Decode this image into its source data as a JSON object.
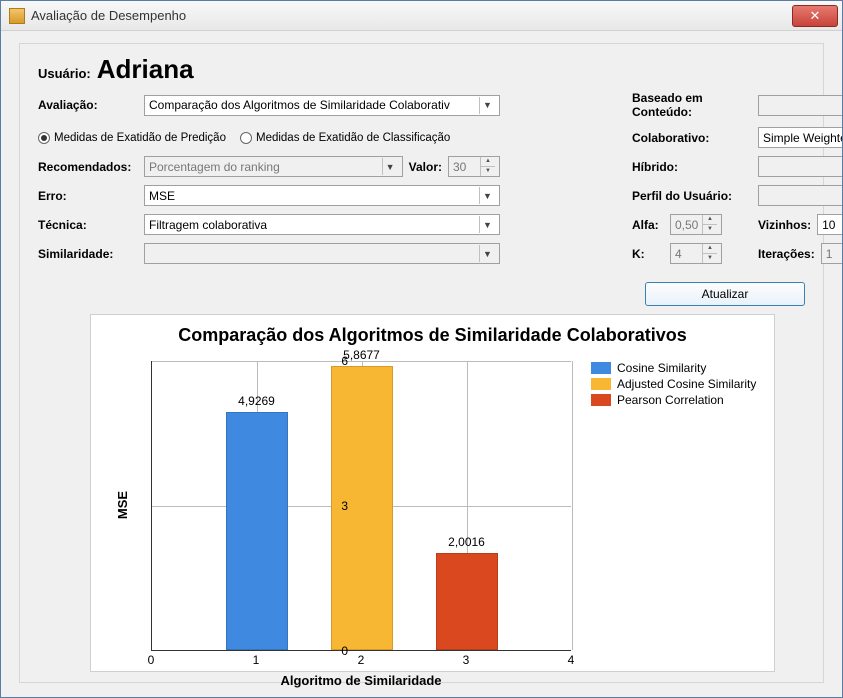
{
  "window": {
    "title": "Avaliação de Desempenho"
  },
  "user": {
    "label": "Usuário:",
    "name": "Adriana"
  },
  "left": {
    "avaliacao_label": "Avaliação:",
    "avaliacao_value": "Comparação dos Algoritmos de Similaridade Colaborativ",
    "radio_predicao": "Medidas de Exatidão de Predição",
    "radio_classificacao": "Medidas de Exatidão de Classificação",
    "recomendados_label": "Recomendados:",
    "recomendados_value": "Porcentagem do ranking",
    "valor_label": "Valor:",
    "valor_value": "30",
    "erro_label": "Erro:",
    "erro_value": "MSE",
    "tecnica_label": "Técnica:",
    "tecnica_value": "Filtragem colaborativa",
    "similaridade_label": "Similaridade:"
  },
  "right": {
    "conteudo_label": "Baseado em Conteúdo:",
    "colaborativo_label": "Colaborativo:",
    "colaborativo_value": "Simple Weighted Average",
    "hibrido_label": "Híbrido:",
    "perfil_label": "Perfil do Usuário:",
    "alfa_label": "Alfa:",
    "alfa_value": "0,50",
    "vizinhos_label": "Vizinhos:",
    "vizinhos_value": "10",
    "k_label": "K:",
    "k_value": "4",
    "iter_label": "Iterações:",
    "iter_value": "1"
  },
  "buttons": {
    "atualizar": "Atualizar"
  },
  "chart_data": {
    "type": "bar",
    "title": "Comparação dos Algoritmos de Similaridade Colaborativos",
    "xlabel": "Algoritmo de Similaridade",
    "ylabel": "MSE",
    "xlim": [
      0,
      4
    ],
    "ylim": [
      0,
      6
    ],
    "categories": [
      1,
      2,
      3
    ],
    "series": [
      {
        "name": "Cosine Similarity",
        "color": "#3f8ae0",
        "values": [
          4.9269,
          null,
          null
        ]
      },
      {
        "name": "Adjusted Cosine Similarity",
        "color": "#f7b733",
        "values": [
          null,
          5.8677,
          null
        ]
      },
      {
        "name": "Pearson Correlation",
        "color": "#d9481f",
        "values": [
          null,
          null,
          2.0016
        ]
      }
    ],
    "data_labels": [
      "4,9269",
      "5,8677",
      "2,0016"
    ],
    "xticks": [
      0,
      1,
      2,
      3,
      4
    ],
    "yticks": [
      0,
      3,
      6
    ]
  }
}
